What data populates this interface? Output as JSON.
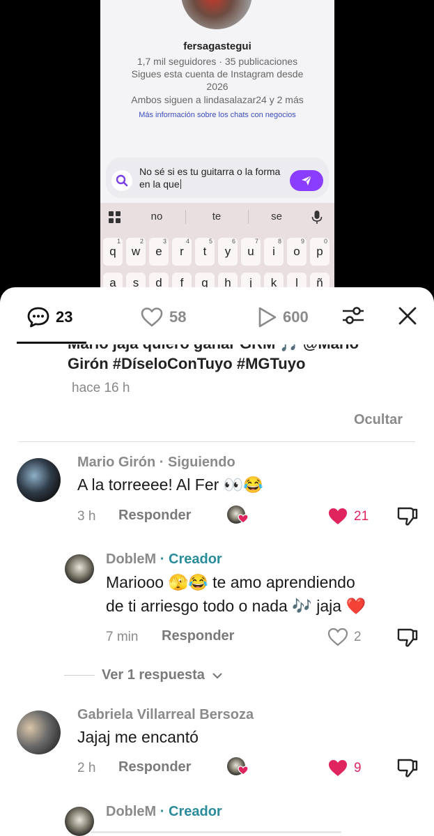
{
  "video": {
    "profile": {
      "username": "fersagastegui",
      "stats": "1,7 mil seguidores · 35 publicaciones",
      "follow_line1": "Sigues esta cuenta de Instagram desde",
      "follow_line2": "2026",
      "mutual": "Ambos siguen a lindasalazar24 y 2 más",
      "more_info_link": "Más información sobre los chats con negocios"
    },
    "message": {
      "text": "No sé si es tu guitarra o la forma en la que",
      "accent": "#8b3dff"
    },
    "keyboard": {
      "suggestions": [
        "no",
        "te",
        "se"
      ],
      "row1": [
        {
          "k": "q",
          "n": "1"
        },
        {
          "k": "w",
          "n": "2"
        },
        {
          "k": "e",
          "n": "3"
        },
        {
          "k": "r",
          "n": "4"
        },
        {
          "k": "t",
          "n": "5"
        },
        {
          "k": "y",
          "n": "6"
        },
        {
          "k": "u",
          "n": "7"
        },
        {
          "k": "i",
          "n": "8"
        },
        {
          "k": "o",
          "n": "9"
        },
        {
          "k": "p",
          "n": "0"
        }
      ],
      "row2": [
        "a",
        "s",
        "d",
        "f",
        "g",
        "h",
        "j",
        "k",
        "l",
        "ñ"
      ]
    }
  },
  "tabs": {
    "comments_count": "23",
    "likes_count": "58",
    "views_count": "600"
  },
  "caption": {
    "partial_line": "Mario jaja quiero ganar GRM 🎵 @Mario",
    "line": "Girón #DíseloConTuyo #MGTuyo",
    "time": "hace 16 h",
    "hide_label": "Ocultar"
  },
  "comments": [
    {
      "author": "Mario Girón",
      "tag": "· Siguiendo",
      "text": "A la torreeee! Al Fer 👀😂",
      "time": "3 h",
      "reply_label": "Responder",
      "likes": "21",
      "liked": true
    },
    {
      "author": "DobleM",
      "tag": "· Creador",
      "text_line1": "Mariooo 🫣😂 te amo aprendiendo",
      "text_line2": "de ti arriesgo todo o nada 🎶 jaja ❤️",
      "time": "7 min",
      "reply_label": "Responder",
      "likes": "2",
      "liked": false
    },
    {
      "author": "Gabriela Villarreal Bersoza",
      "text": "Jajaj me encantó",
      "time": "2 h",
      "reply_label": "Responder",
      "likes": "9",
      "liked": true
    },
    {
      "author": "DobleM",
      "tag": "· Creador"
    }
  ],
  "more_replies_label": "Ver 1 respuesta",
  "colors": {
    "like_red": "#e0245e",
    "creator_teal": "#2a8c9a",
    "send_purple": "#8b3dff"
  }
}
